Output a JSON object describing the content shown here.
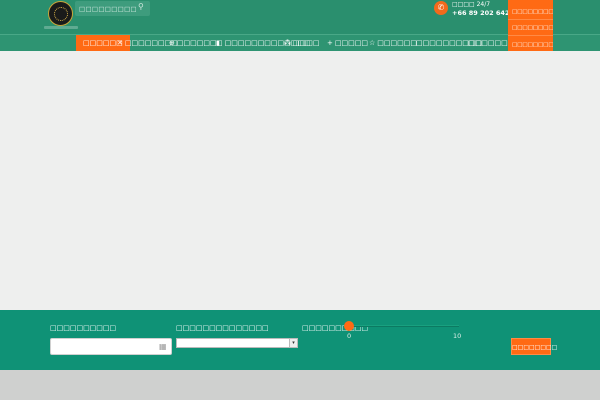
{
  "header": {
    "search": {
      "placeholder": "□□□□□□□□□□□□□",
      "icon": "search-icon"
    },
    "contact": {
      "label": "□□□□ 24/7",
      "phone": "+66 89 202 6420",
      "icon": "phone-icon"
    }
  },
  "nav": {
    "items": [
      {
        "label": "□□□□□□",
        "icon": "",
        "active": true
      },
      {
        "label": "□□□□□□□□",
        "icon": "✕"
      },
      {
        "label": "□□□□□□",
        "icon": "⊕"
      },
      {
        "label": "□□□□□□□□□□□□□",
        "icon": "◧"
      },
      {
        "label": "□□□□",
        "icon": "⁂"
      },
      {
        "label": "□□□□□",
        "icon": "+"
      },
      {
        "label": "□□□□□□",
        "icon": "☆"
      },
      {
        "label": "□□□□□□□□□□",
        "icon": ""
      },
      {
        "label": "□□□□□□□□□□",
        "icon": ""
      }
    ],
    "dropdown": [
      "□□□□□□□□",
      "□□□□□□□□",
      "□□□□□□□□",
      "□□□□□"
    ]
  },
  "filters": {
    "date_label": "□□□□□□□□□□",
    "select_label": "□□□□□□□□□□□□□□",
    "slider_label": "□□□□□□□□□□",
    "slider_min": "0",
    "slider_max": "10",
    "slider_value": 0,
    "search_button": "□□□□□□□□"
  },
  "colors": {
    "brand_green": "#2a8f6e",
    "accent_orange": "#ff6a14",
    "filter_green": "#0f9276"
  }
}
